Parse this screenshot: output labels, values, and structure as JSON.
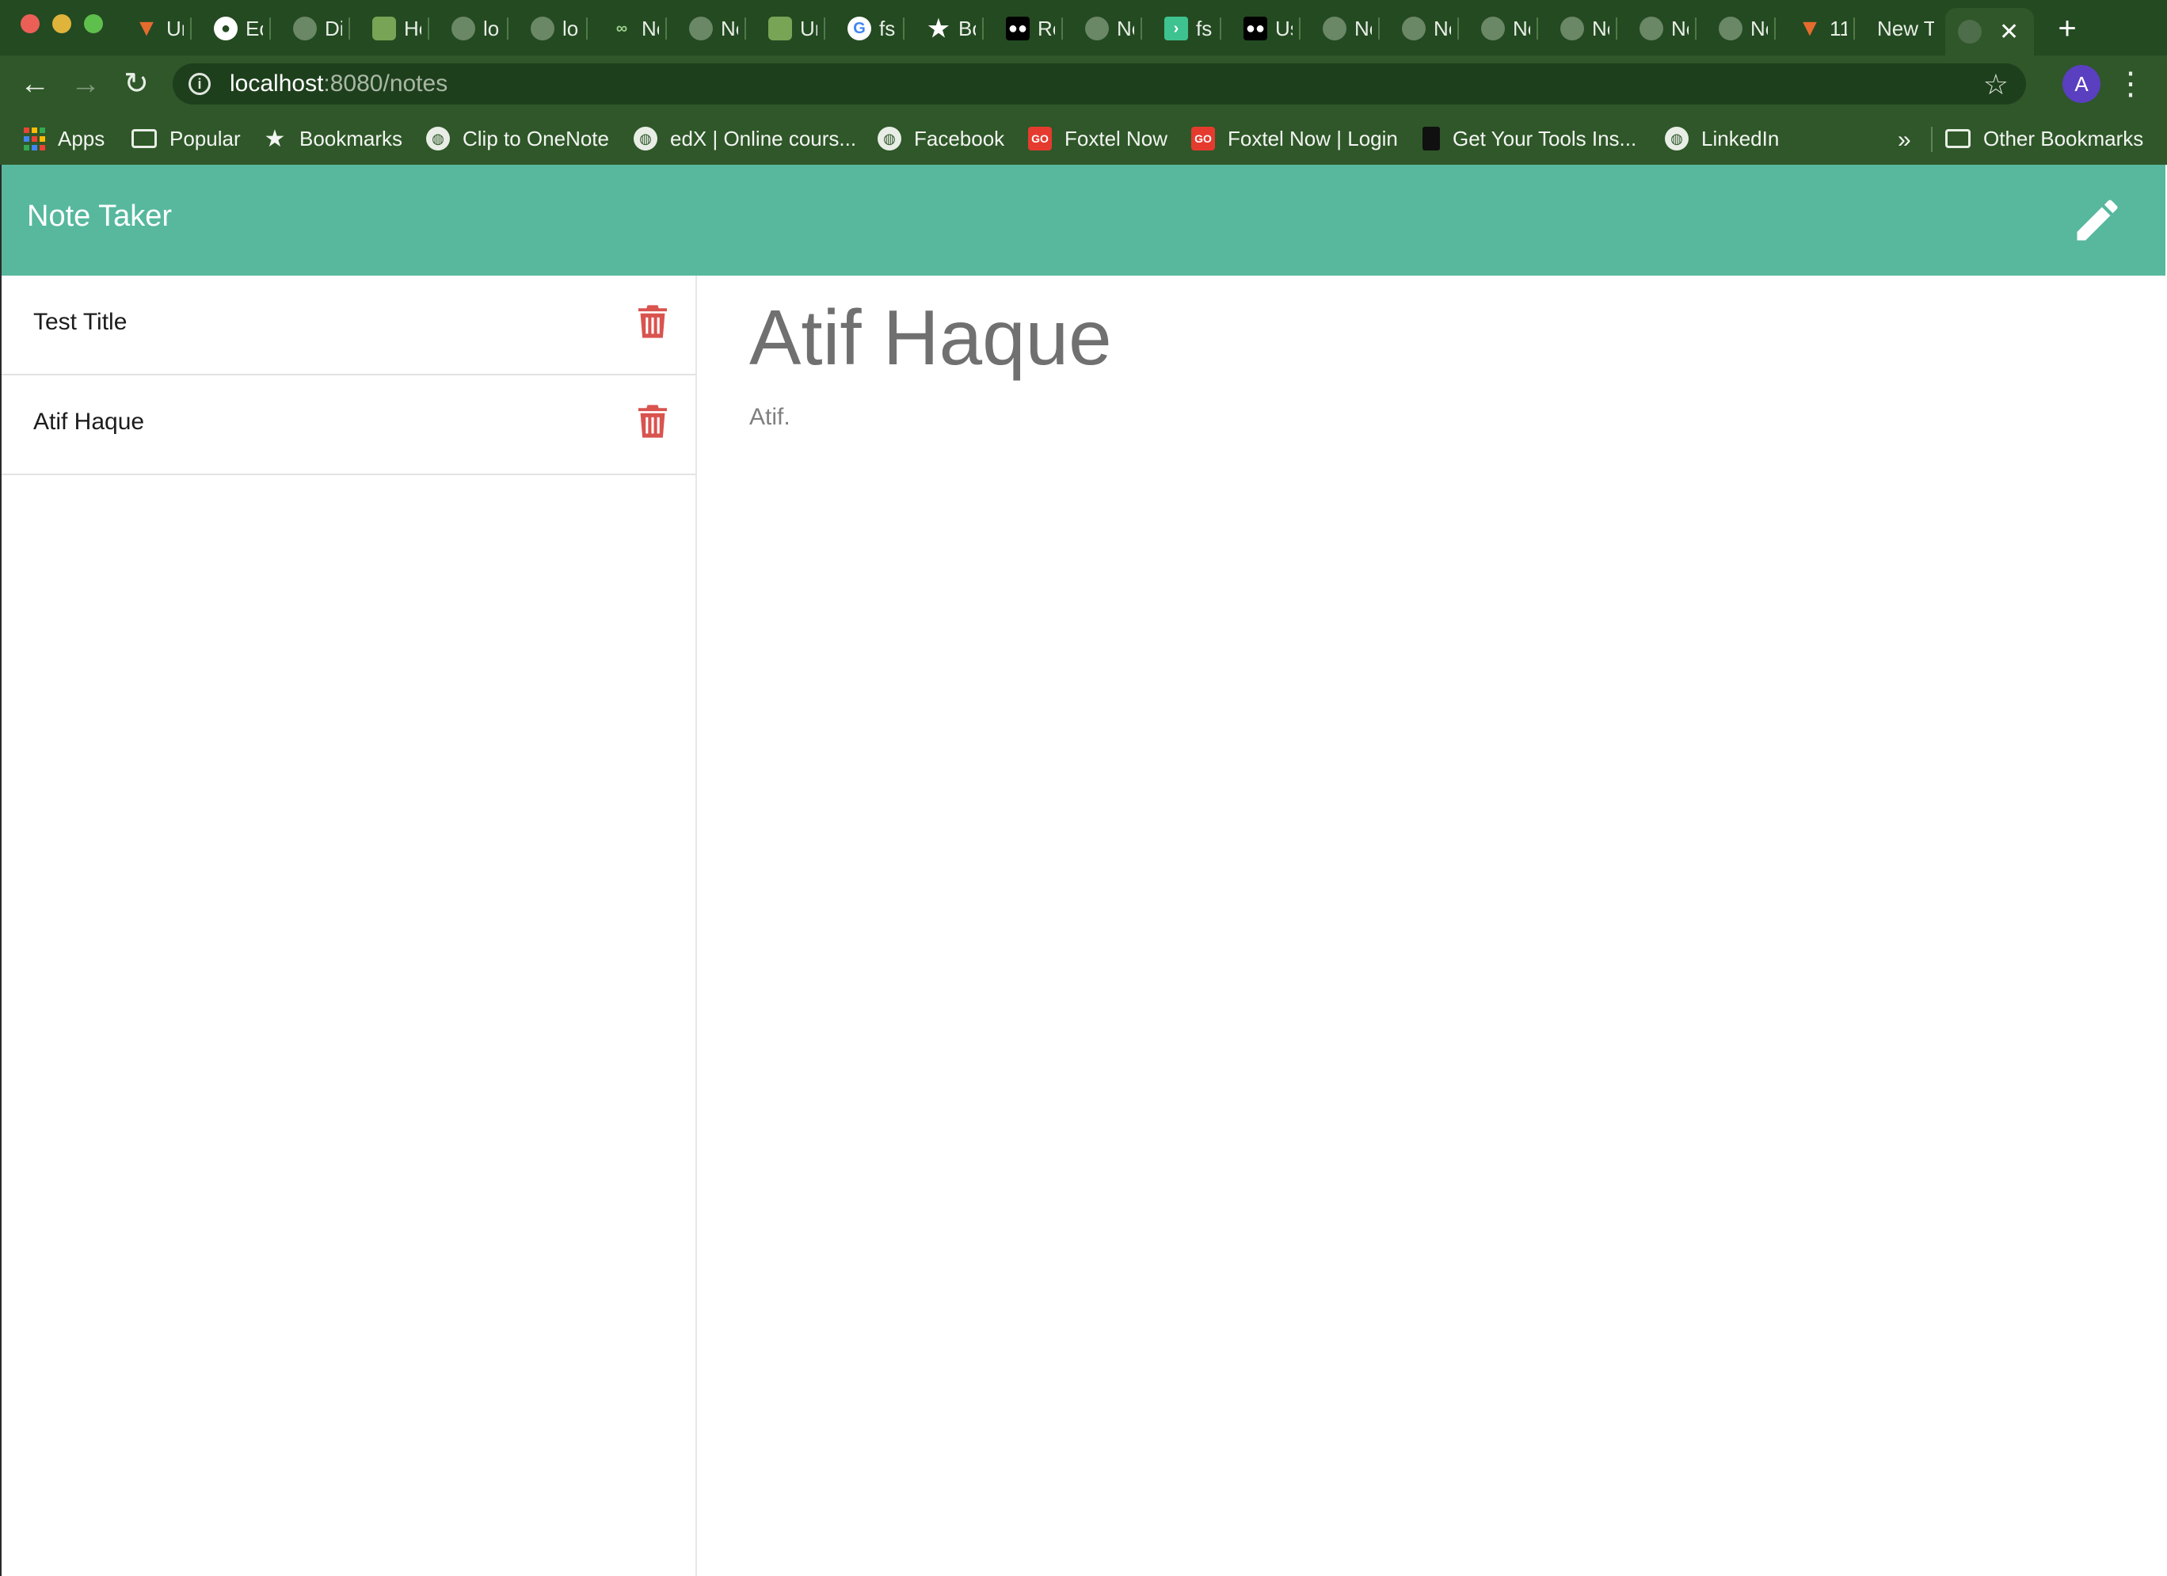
{
  "browser": {
    "tabs": [
      {
        "icon": "gitlab-icon",
        "label": "Ur"
      },
      {
        "icon": "github-icon",
        "label": "Ec"
      },
      {
        "icon": "globe-icon",
        "label": "Di"
      },
      {
        "icon": "node-icon",
        "label": "He"
      },
      {
        "icon": "globe-icon",
        "label": "lo"
      },
      {
        "icon": "globe-icon",
        "label": "lo"
      },
      {
        "icon": "infinity-icon",
        "label": "Ne"
      },
      {
        "icon": "globe-icon",
        "label": "Ne"
      },
      {
        "icon": "node-icon",
        "label": "Ur"
      },
      {
        "icon": "google-icon",
        "label": "fs"
      },
      {
        "icon": "star-icon",
        "label": "Bo"
      },
      {
        "icon": "medium-icon",
        "label": "Re"
      },
      {
        "icon": "globe-icon",
        "label": "Ne"
      },
      {
        "icon": "terminal-icon",
        "label": "fs"
      },
      {
        "icon": "medium-icon",
        "label": "Us"
      },
      {
        "icon": "globe-icon",
        "label": "Ne"
      },
      {
        "icon": "globe-icon",
        "label": "Ne"
      },
      {
        "icon": "globe-icon",
        "label": "Ne"
      },
      {
        "icon": "globe-icon",
        "label": "Ne"
      },
      {
        "icon": "globe-icon",
        "label": "Ne"
      },
      {
        "icon": "globe-icon",
        "label": "Ne"
      },
      {
        "icon": "gitlab-icon",
        "label": "11"
      }
    ],
    "new_tab_label": "New T",
    "url_host": "localhost",
    "url_rest": ":8080/notes",
    "profile_initial": "A",
    "bookmarks": {
      "apps": "Apps",
      "popular": "Popular",
      "bookmarks": "Bookmarks",
      "clip": "Clip to OneNote",
      "edx": "edX | Online cours...",
      "facebook": "Facebook",
      "foxtel": "Foxtel Now",
      "foxtel_login": "Foxtel Now | Login",
      "tools": "Get Your Tools Ins...",
      "linkedin": "LinkedIn",
      "more": "»",
      "other": "Other Bookmarks"
    }
  },
  "app": {
    "title": "Note Taker",
    "accent": "#57b89e",
    "delete_color": "#d9534f",
    "notes": [
      {
        "title": "Test Title"
      },
      {
        "title": "Atif Haque"
      }
    ],
    "active_note": {
      "title": "Atif Haque",
      "text": "Atif."
    }
  }
}
